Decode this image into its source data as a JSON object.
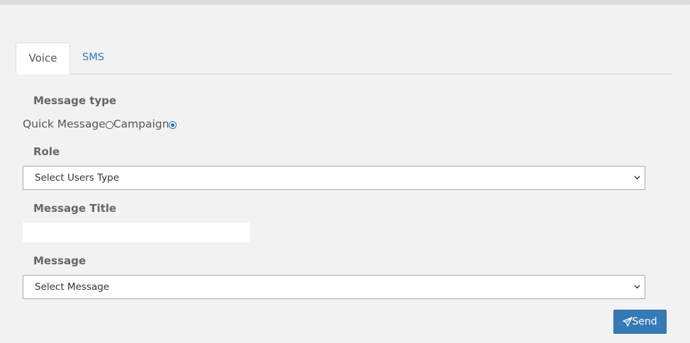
{
  "tabs": [
    {
      "label": "Voice",
      "active": true
    },
    {
      "label": "SMS",
      "active": false
    }
  ],
  "message_type": {
    "label": "Message type",
    "options": [
      {
        "label": "Quick Message",
        "checked": false
      },
      {
        "label": "Campaign",
        "checked": true
      }
    ]
  },
  "role": {
    "label": "Role",
    "selected": "Select Users Type"
  },
  "message_title": {
    "label": "Message Title",
    "value": ""
  },
  "message": {
    "label": "Message",
    "selected": "Select Message"
  },
  "send_button": {
    "label": "Send",
    "icon": "send-icon"
  },
  "colors": {
    "accent": "#337ab7",
    "radio_checked": "#1a73e8",
    "background": "#f2f2f2"
  }
}
